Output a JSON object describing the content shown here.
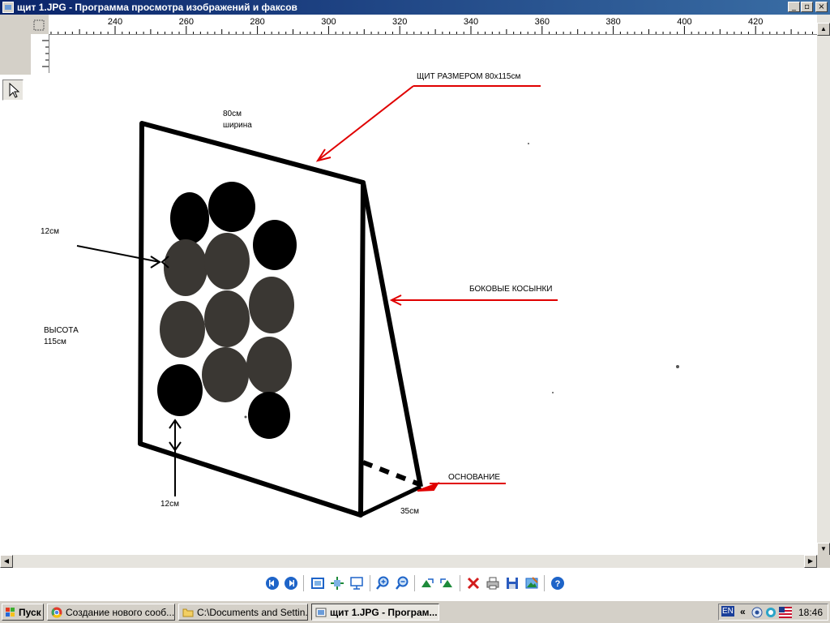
{
  "window": {
    "title": "щит 1.JPG - Программа просмотра изображений и факсов",
    "buttons": {
      "minimize": "_",
      "restore": "▫",
      "close": "×"
    }
  },
  "ruler": {
    "labels": [
      "240",
      "260",
      "280",
      "300",
      "320",
      "340",
      "360",
      "380",
      "400",
      "420"
    ]
  },
  "image": {
    "label_top": "ЩИТ  РАЗМЕРОМ  80х115см",
    "label_width_value": "80см",
    "label_width_word": "ширина",
    "label_margin_side": "12см",
    "label_height_word": "ВЫСОТА",
    "label_height_value": "115см",
    "label_gussets": "БОКОВЫЕ  КОСЫНКИ",
    "label_base": "ОСНОВАНИЕ",
    "label_base_value": "35см",
    "label_margin_bottom": "12см",
    "colors": {
      "annotation_arrow": "#e00000",
      "outline": "#000000",
      "disc_grey": "#3a3733"
    }
  },
  "viewer_toolbar": {
    "buttons": [
      "previous-image",
      "next-image",
      "best-fit",
      "actual-size",
      "slideshow",
      "zoom-in",
      "zoom-out",
      "rotate-clockwise",
      "rotate-counterclockwise",
      "delete",
      "print",
      "copy-to",
      "open-for-editing",
      "help"
    ]
  },
  "taskbar": {
    "start_label": "Пуск",
    "tasks": [
      {
        "label": "Создание нового сооб..."
      },
      {
        "label": "C:\\Documents and Settin..."
      },
      {
        "label": "щит 1.JPG - Програм..."
      }
    ],
    "tray": {
      "language": "EN",
      "expand": "«",
      "time": "18:46"
    }
  }
}
